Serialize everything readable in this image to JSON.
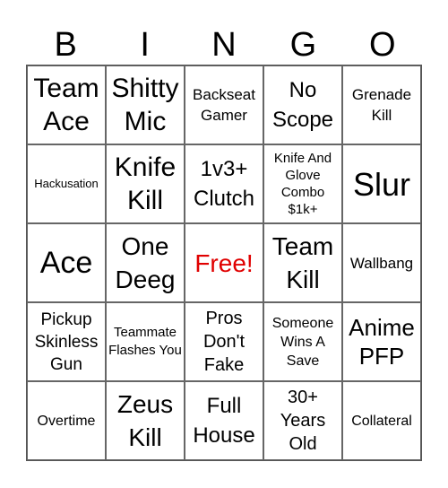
{
  "header": {
    "letters": [
      "B",
      "I",
      "N",
      "G",
      "O"
    ]
  },
  "free_color": "#e00000",
  "cells": [
    "Team Ace",
    "Shitty Mic",
    "Backseat Gamer",
    "No Scope",
    "Grenade Kill",
    "Hackusation",
    "Knife Kill",
    "1v3+ Clutch",
    "Knife And Glove Combo $1k+",
    "Slur",
    "Ace",
    "One Deeg",
    "Free!",
    "Team Kill",
    "Wallbang",
    "Pickup Skinless Gun",
    "Teammate Flashes You",
    "Pros Don't Fake",
    "Someone Wins A Save",
    "Anime PFP",
    "Overtime",
    "Zeus Kill",
    "Full House",
    "30+ Years Old",
    "Collateral"
  ]
}
